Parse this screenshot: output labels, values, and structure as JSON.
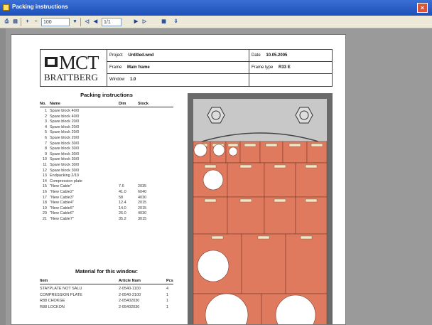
{
  "window": {
    "title": "Packing instructions"
  },
  "toolbar": {
    "zoom_value": "100",
    "page_value": "1/1"
  },
  "header": {
    "project_label": "Project",
    "project_value": "Untitled.wnd",
    "frame_label": "Frame",
    "frame_value": "Main frame",
    "window_label": "Window",
    "window_value": "1.0",
    "date_label": "Date",
    "date_value": "10.05.2005",
    "frame_type_label": "Frame type",
    "frame_type_value": "R33 E",
    "logo_text": "MCT",
    "logo_subtext": "BRATTBERG"
  },
  "packing": {
    "title": "Packing instructions",
    "columns": {
      "no": "No.",
      "name": "Name",
      "dim": "Dim",
      "stock": "Stock"
    },
    "rows": [
      {
        "no": "1",
        "name": "Spare block 40/0",
        "dim": "",
        "stock": ""
      },
      {
        "no": "2",
        "name": "Spare block 40/0",
        "dim": "",
        "stock": ""
      },
      {
        "no": "3",
        "name": "Spare block 20/0",
        "dim": "",
        "stock": ""
      },
      {
        "no": "4",
        "name": "Spare block 20/0",
        "dim": "",
        "stock": ""
      },
      {
        "no": "5",
        "name": "Spare block 20/0",
        "dim": "",
        "stock": ""
      },
      {
        "no": "6",
        "name": "Spare block 20/0",
        "dim": "",
        "stock": ""
      },
      {
        "no": "7",
        "name": "Spare block 30/0",
        "dim": "",
        "stock": ""
      },
      {
        "no": "8",
        "name": "Spare block 30/0",
        "dim": "",
        "stock": ""
      },
      {
        "no": "9",
        "name": "Spare block 30/0",
        "dim": "",
        "stock": ""
      },
      {
        "no": "10",
        "name": "Spare block 30/0",
        "dim": "",
        "stock": ""
      },
      {
        "no": "11",
        "name": "Spare block 30/0",
        "dim": "",
        "stock": ""
      },
      {
        "no": "12",
        "name": "Spare block 30/0",
        "dim": "",
        "stock": ""
      },
      {
        "no": "13",
        "name": "Endpacking 2/10",
        "dim": "",
        "stock": ""
      },
      {
        "no": "14",
        "name": "Compression plate",
        "dim": "",
        "stock": ""
      },
      {
        "no": "15",
        "name": "\"New Cable\"",
        "dim": "7.6",
        "stock": "2035"
      },
      {
        "no": "16",
        "name": "\"New Cable2\"",
        "dim": "41.0",
        "stock": "6040"
      },
      {
        "no": "17",
        "name": "\"New Cable3\"",
        "dim": "58",
        "stock": "4030"
      },
      {
        "no": "18",
        "name": "\"New Cable4\"",
        "dim": "12.4",
        "stock": "2015"
      },
      {
        "no": "19",
        "name": "\"New Cable5\"",
        "dim": "14.0",
        "stock": "2015"
      },
      {
        "no": "20",
        "name": "\"New Cable6\"",
        "dim": "26.0",
        "stock": "4030"
      },
      {
        "no": "21",
        "name": "\"New Cable7\"",
        "dim": "35.2",
        "stock": "3015"
      }
    ]
  },
  "materials": {
    "title": "Material for this window:",
    "columns": {
      "item": "Item",
      "article": "Article Num",
      "pcs": "Pcs"
    },
    "rows": [
      {
        "item": "STAYPLATE NOT SALU",
        "article": "2-0540-1100",
        "pcs": "4"
      },
      {
        "item": "COMPRESSION PLATE",
        "article": "2-0540-2100",
        "pcs": "1"
      },
      {
        "item": "R88 CHOKGE",
        "article": "2-05402030",
        "pcs": "1"
      },
      {
        "item": "R88 LOCKON",
        "article": "2-05402030",
        "pcs": "1"
      }
    ]
  },
  "drawing": {
    "frame_color": "#6a6a6a",
    "plate_color": "#c8c8c8",
    "module_color": "#e07a5f",
    "label_color": "#f2e6c8"
  }
}
